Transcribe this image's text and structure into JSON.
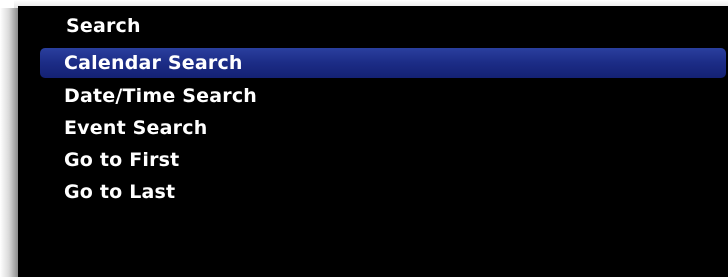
{
  "menu": {
    "title": "Search",
    "items": [
      {
        "label": "Calendar Search",
        "selected": true
      },
      {
        "label": "Date/Time Search",
        "selected": false
      },
      {
        "label": "Event Search",
        "selected": false
      },
      {
        "label": "Go to First",
        "selected": false
      },
      {
        "label": "Go to Last",
        "selected": false
      }
    ]
  },
  "colors": {
    "background": "#000000",
    "text": "#ffffff",
    "selection": "#1c2c86"
  }
}
